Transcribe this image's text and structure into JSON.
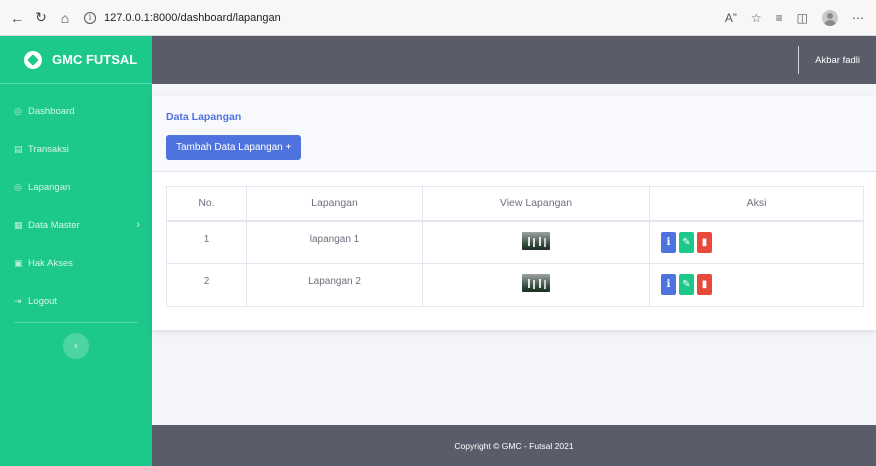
{
  "browser": {
    "url": "127.0.0.1:8000/dashboard/lapangan",
    "back_icon": "arrow-left",
    "reload_icon": "reload",
    "home_icon": "home"
  },
  "sidebar": {
    "brand": "GMC FUTSAL",
    "items": [
      {
        "label": "Dashboard",
        "icon": "◎"
      },
      {
        "label": "Transaksi",
        "icon": "▤"
      },
      {
        "label": "Lapangan",
        "icon": "◎"
      },
      {
        "label": "Data Master",
        "icon": "▦"
      },
      {
        "label": "Hak Akses",
        "icon": "▣"
      },
      {
        "label": "Logout",
        "icon": "⇥"
      }
    ],
    "collapse_icon": "‹"
  },
  "topbar": {
    "user_name": "Akbar fadli"
  },
  "card": {
    "title": "Data Lapangan",
    "add_button": "Tambah Data Lapangan +"
  },
  "table": {
    "headers": [
      "No.",
      "Lapangan",
      "View Lapangan",
      "Aksi"
    ],
    "rows": [
      {
        "no": "1",
        "name": "lapangan 1"
      },
      {
        "no": "2",
        "name": "Lapangan 2"
      }
    ],
    "action_info": "i",
    "action_edit": "✎",
    "action_delete": "▮"
  },
  "footer": {
    "text": "Copyright © GMC - Futsal 2021"
  },
  "colors": {
    "sidebar": "#1cc88a",
    "topbar": "#5a5c69",
    "primary": "#4e73df",
    "success": "#1cc88a",
    "danger": "#e74a3b"
  }
}
